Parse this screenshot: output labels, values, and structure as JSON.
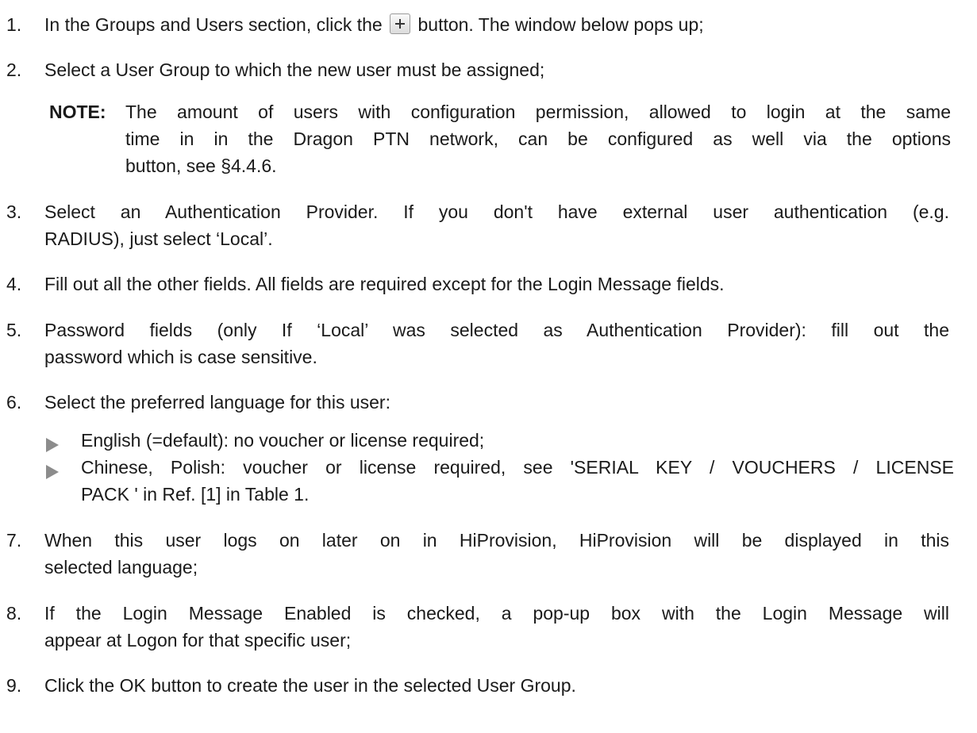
{
  "step1": {
    "num": "1.",
    "before": "In the Groups and Users section, click the",
    "after": "button. The window below pops up;",
    "icon": "plus-icon"
  },
  "step2": {
    "num": "2.",
    "text": "Select a User Group to which the new user must be assigned;"
  },
  "note": {
    "label": "NOTE:",
    "line1": "The amount of users with configuration permission, allowed to login at the same",
    "line2": "time in in the Dragon PTN network, can be configured as well via the options",
    "line3": "button, see §4.4.6."
  },
  "step3": {
    "num": "3.",
    "line1": "Select an Authentication Provider. If you don't have external user authentication (e.g.",
    "line2": "RADIUS), just select ‘Local’."
  },
  "step4": {
    "num": "4.",
    "text": "Fill out all the other fields. All fields are required except for the Login Message fields."
  },
  "step5": {
    "num": "5.",
    "line1": "Password fields (only If ‘Local’ was selected as Authentication Provider): fill out the",
    "line2": "password which is case sensitive."
  },
  "step6": {
    "num": "6.",
    "text": "Select the preferred language for this user:"
  },
  "bullets": {
    "b1": "English (=default): no voucher or license required;",
    "b2_line1": "Chinese, Polish: voucher or license required, see 'SERIAL KEY / VOUCHERS / LICENSE",
    "b2_line2": "PACK ' in Ref. [1] in Table 1."
  },
  "step7": {
    "num": "7.",
    "line1": "When this user logs on later on in HiProvision, HiProvision will be displayed in this",
    "line2": "selected language;"
  },
  "step8": {
    "num": "8.",
    "line1": "If the Login Message Enabled is checked, a pop-up box with the Login Message will",
    "line2": "appear at Logon for that specific user;"
  },
  "step9": {
    "num": "9.",
    "text": "Click the OK button to create the user in the selected User Group."
  },
  "colors": {
    "text": "#1a1a1a",
    "bullet": "#8c8c8c"
  }
}
